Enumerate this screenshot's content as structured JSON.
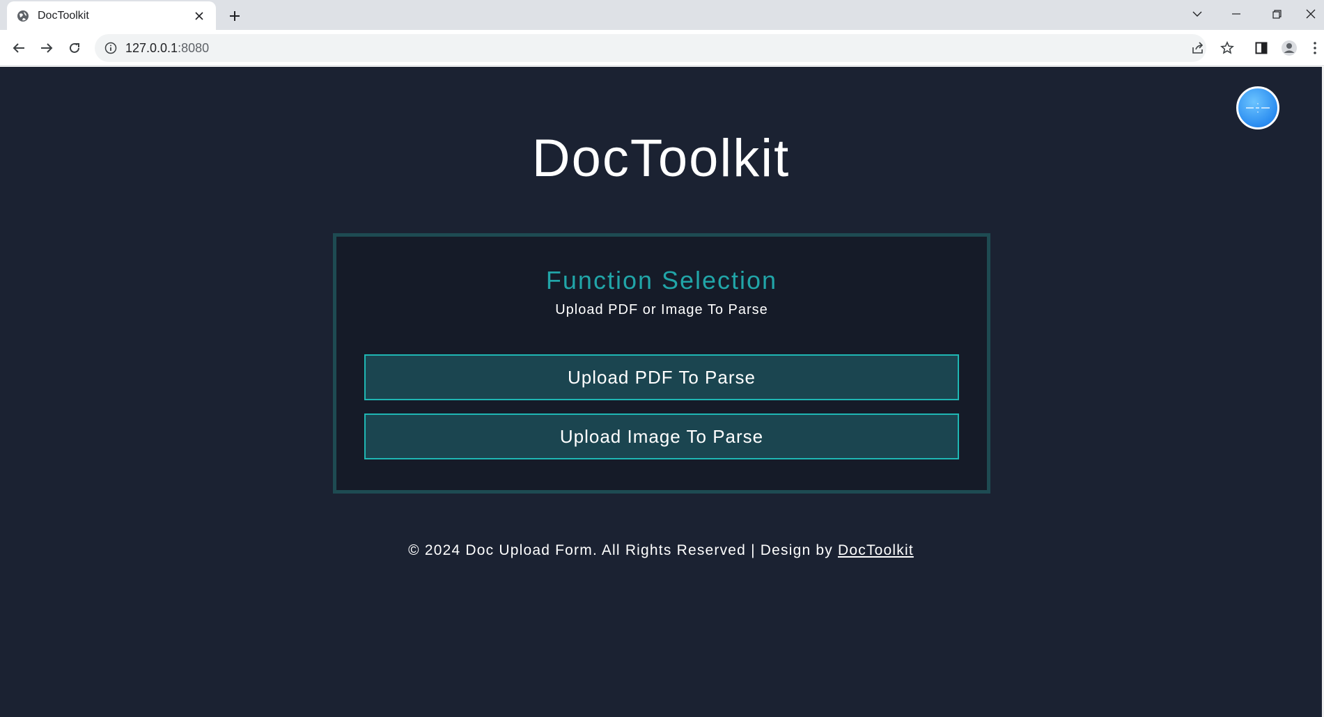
{
  "browser": {
    "tab_title": "DocToolkit",
    "url_host": "127.0.0.1",
    "url_port": ":8080"
  },
  "page": {
    "title": "DocToolkit",
    "card": {
      "heading": "Function Selection",
      "subheading": "Upload PDF or Image To Parse",
      "buttons": [
        {
          "label": "Upload PDF To Parse"
        },
        {
          "label": "Upload Image To Parse"
        }
      ]
    },
    "footer": {
      "text": "© 2024 Doc Upload Form. All Rights Reserved | Design by ",
      "link_text": "DocToolkit"
    }
  },
  "colors": {
    "page_background": "#1b2232",
    "card_border": "#1e4b52",
    "heading_accent": "#21a5a8",
    "button_fill": "#1b4550",
    "button_border": "#1fb7b4"
  },
  "icons": [
    "globe-icon",
    "close-icon",
    "plus-icon",
    "chevron-down-icon",
    "minimize-icon",
    "restore-icon",
    "back-arrow-icon",
    "forward-arrow-icon",
    "reload-icon",
    "info-icon",
    "share-icon",
    "star-icon",
    "side-panel-icon",
    "profile-icon",
    "menu-dots-icon"
  ]
}
